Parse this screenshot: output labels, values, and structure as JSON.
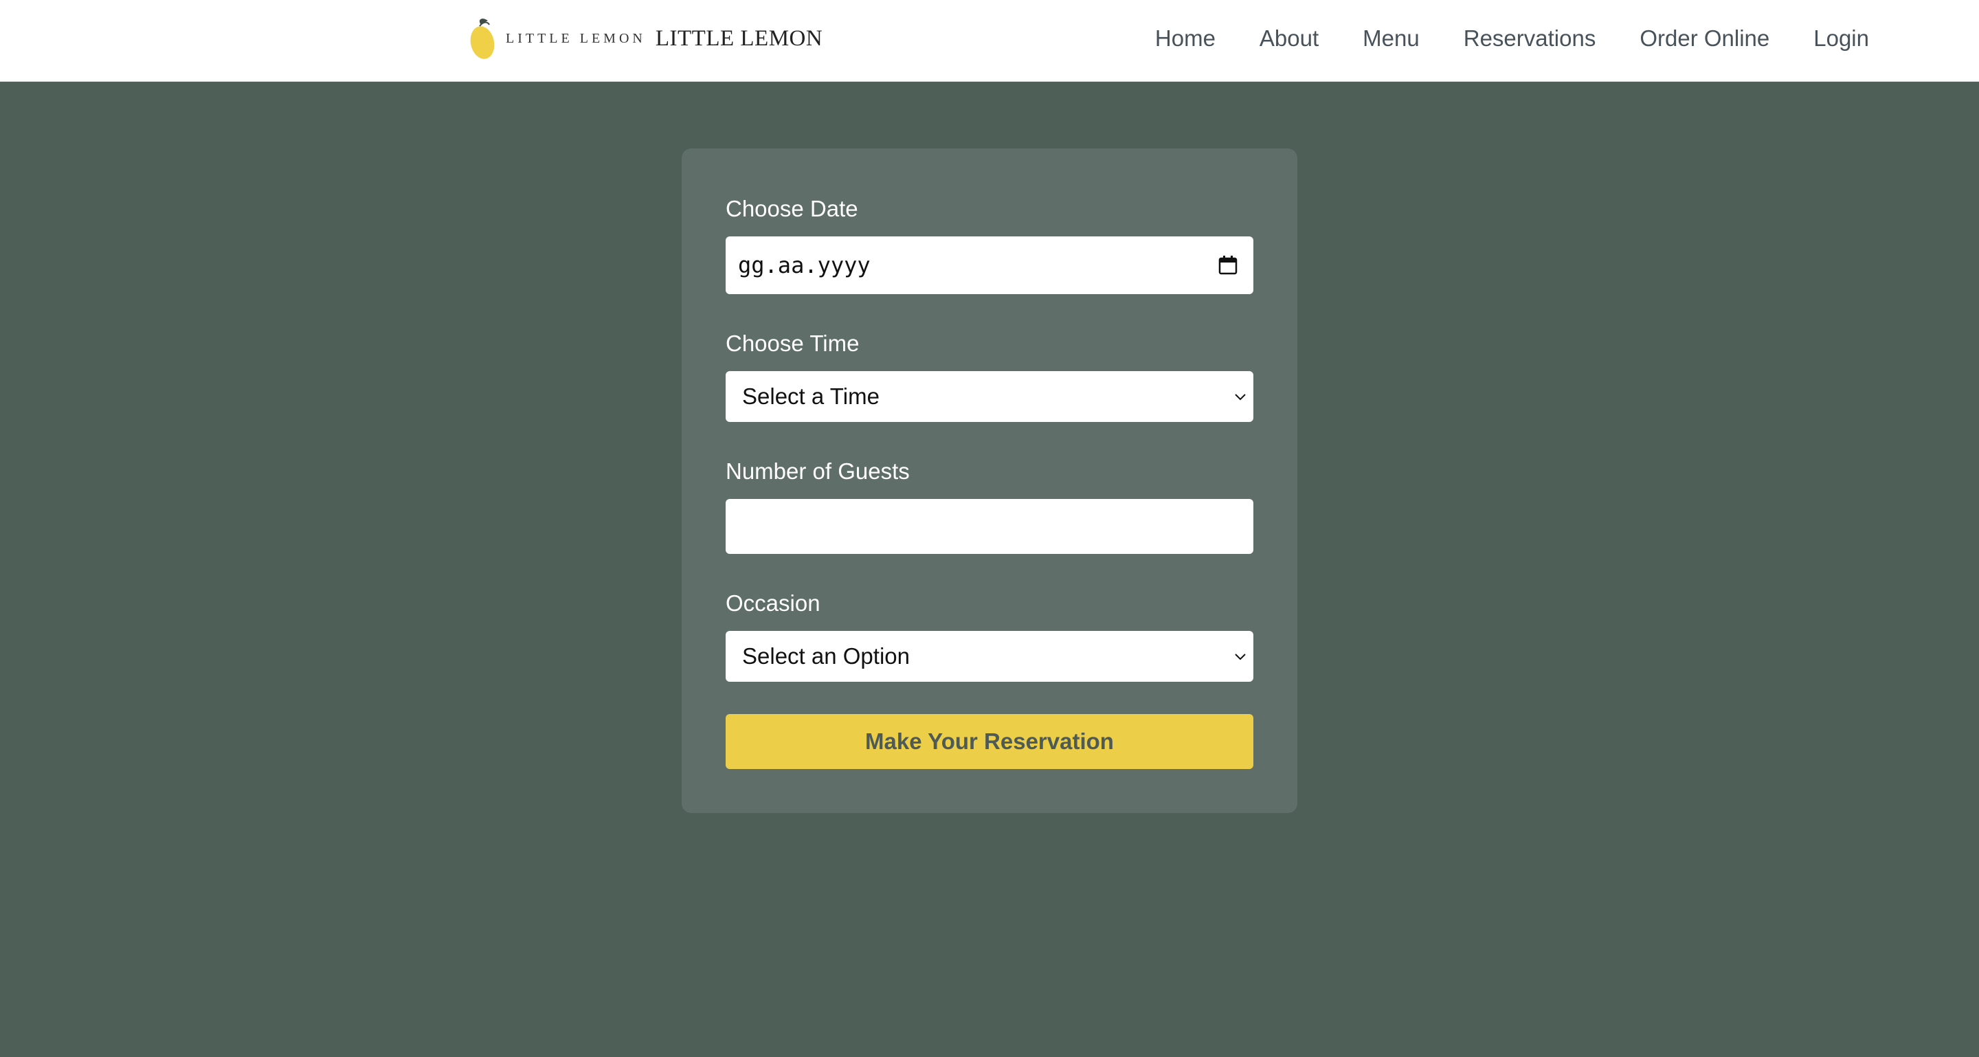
{
  "brand": {
    "small_text": "LITTLE LEMON",
    "big_text": "LITTLE LEMON",
    "logo_icon": "lemon-icon",
    "logo_color": "#efd047"
  },
  "nav": {
    "items": [
      {
        "label": "Home"
      },
      {
        "label": "About"
      },
      {
        "label": "Menu"
      },
      {
        "label": "Reservations"
      },
      {
        "label": "Order Online"
      },
      {
        "label": "Login"
      }
    ]
  },
  "form": {
    "date": {
      "label": "Choose Date",
      "placeholder": "gg.aa.yyyy",
      "icon": "calendar-icon"
    },
    "time": {
      "label": "Choose Time",
      "selected": "Select a Time",
      "icon": "chevron-down-icon"
    },
    "guests": {
      "label": "Number of Guests",
      "value": ""
    },
    "occasion": {
      "label": "Occasion",
      "selected": "Select an Option",
      "icon": "chevron-down-icon"
    },
    "submit_label": "Make Your Reservation"
  },
  "colors": {
    "page_background": "#4e5f57",
    "card_background": "#5f6e69",
    "accent": "#edce49",
    "nav_text": "#48525a"
  }
}
